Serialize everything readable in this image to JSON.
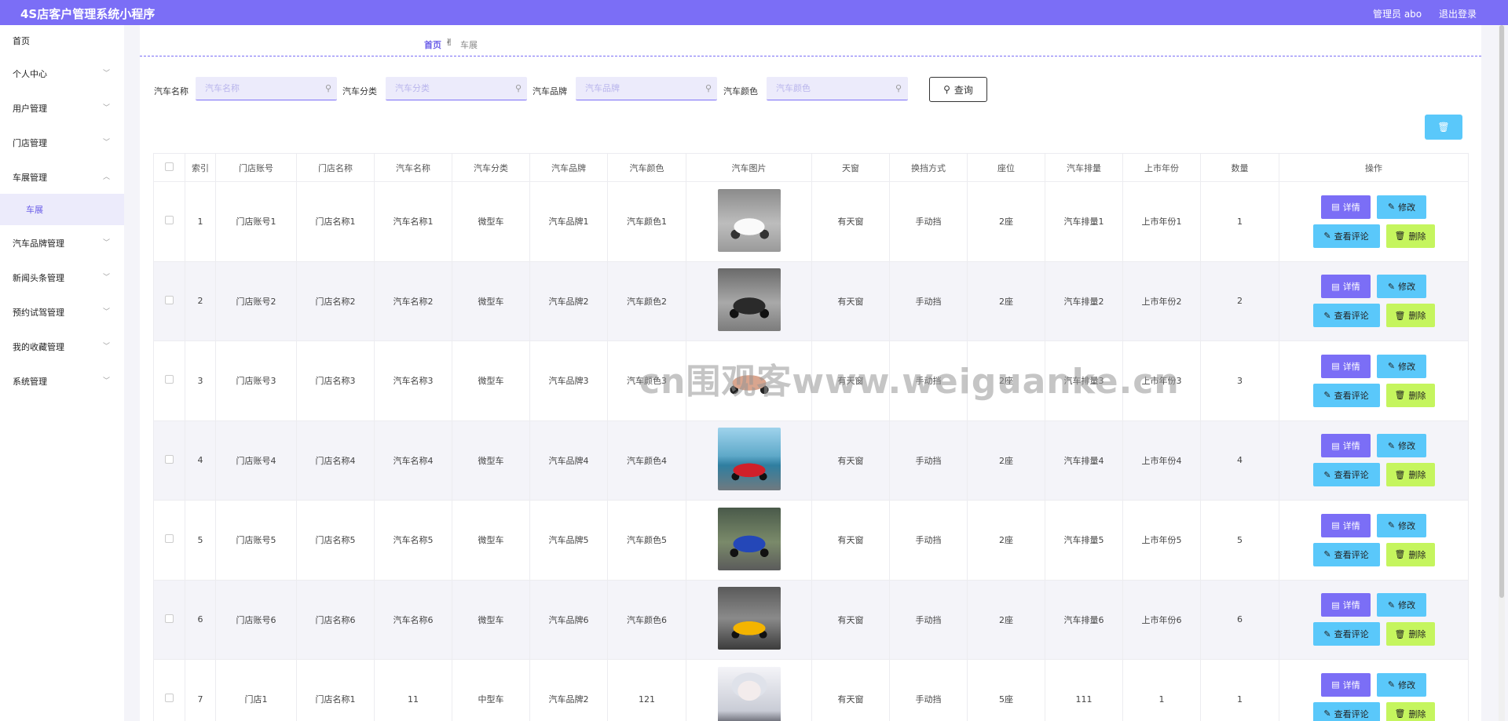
{
  "header": {
    "title": "4S店客户管理系统小程序",
    "admin": "管理员 abo",
    "logout": "退出登录",
    "color": "#7b6ef6"
  },
  "sidebar": {
    "items": [
      {
        "label": "首页",
        "expandable": false
      },
      {
        "label": "个人中心",
        "expandable": true
      },
      {
        "label": "用户管理",
        "expandable": true
      },
      {
        "label": "门店管理",
        "expandable": true
      },
      {
        "label": "车展管理",
        "expandable": true,
        "expanded": true
      },
      {
        "label": "车展",
        "sub": true
      },
      {
        "label": "汽车品牌管理",
        "expandable": true
      },
      {
        "label": "新闻头条管理",
        "expandable": true
      },
      {
        "label": "预约试驾管理",
        "expandable": true
      },
      {
        "label": "我的收藏管理",
        "expandable": true
      },
      {
        "label": "系统管理",
        "expandable": true
      }
    ]
  },
  "breadcrumb": {
    "home": "首页",
    "separator": "✌",
    "current": "车展"
  },
  "search": {
    "fields": [
      {
        "label": "汽车名称",
        "placeholder": "汽车名称"
      },
      {
        "label": "汽车分类",
        "placeholder": "汽车分类"
      },
      {
        "label": "汽车品牌",
        "placeholder": "汽车品牌"
      },
      {
        "label": "汽车颜色",
        "placeholder": "汽车颜色"
      }
    ],
    "query_label": "查询"
  },
  "table": {
    "headers": [
      "",
      "索引",
      "门店账号",
      "门店名称",
      "汽车名称",
      "汽车分类",
      "汽车品牌",
      "汽车颜色",
      "汽车图片",
      "天窗",
      "换挡方式",
      "座位",
      "汽车排量",
      "上市年份",
      "数量",
      "操作"
    ],
    "rows": [
      [
        "1",
        "门店账号1",
        "门店名称1",
        "汽车名称1",
        "微型车",
        "汽车品牌1",
        "汽车颜色1",
        "white-roadster",
        "有天窗",
        "手动挡",
        "2座",
        "汽车排量1",
        "上市年份1",
        "1"
      ],
      [
        "2",
        "门店账号2",
        "门店名称2",
        "汽车名称2",
        "微型车",
        "汽车品牌2",
        "汽车颜色2",
        "black-roadster",
        "有天窗",
        "手动挡",
        "2座",
        "汽车排量2",
        "上市年份2",
        "2"
      ],
      [
        "3",
        "门店账号3",
        "门店名称3",
        "汽车名称3",
        "微型车",
        "汽车品牌3",
        "汽车颜色3",
        "pink-roadster",
        "有天窗",
        "手动挡",
        "2座",
        "汽车排量3",
        "上市年份3",
        "3"
      ],
      [
        "4",
        "门店账号4",
        "门店名称4",
        "汽车名称4",
        "微型车",
        "汽车品牌4",
        "汽车颜色4",
        "red-convertible",
        "有天窗",
        "手动挡",
        "2座",
        "汽车排量4",
        "上市年份4",
        "4"
      ],
      [
        "5",
        "门店账号5",
        "门店名称5",
        "汽车名称5",
        "微型车",
        "汽车品牌5",
        "汽车颜色5",
        "blue-coupe",
        "有天窗",
        "手动挡",
        "2座",
        "汽车排量5",
        "上市年份5",
        "5"
      ],
      [
        "6",
        "门店账号6",
        "门店名称6",
        "汽车名称6",
        "微型车",
        "汽车品牌6",
        "汽车颜色6",
        "yellow-supercar",
        "有天窗",
        "手动挡",
        "2座",
        "汽车排量6",
        "上市年份6",
        "6"
      ],
      [
        "7",
        "门店1",
        "门店名称1",
        "11",
        "中型车",
        "汽车品牌2",
        "121",
        "anime-portrait",
        "有天窗",
        "手动挡",
        "5座",
        "111",
        "1",
        "1"
      ]
    ],
    "actions": {
      "detail": "详情",
      "edit": "修改",
      "comment": "查看评论",
      "delete": "删除"
    }
  },
  "watermark": "cn围观客www.weiguanke.cn"
}
